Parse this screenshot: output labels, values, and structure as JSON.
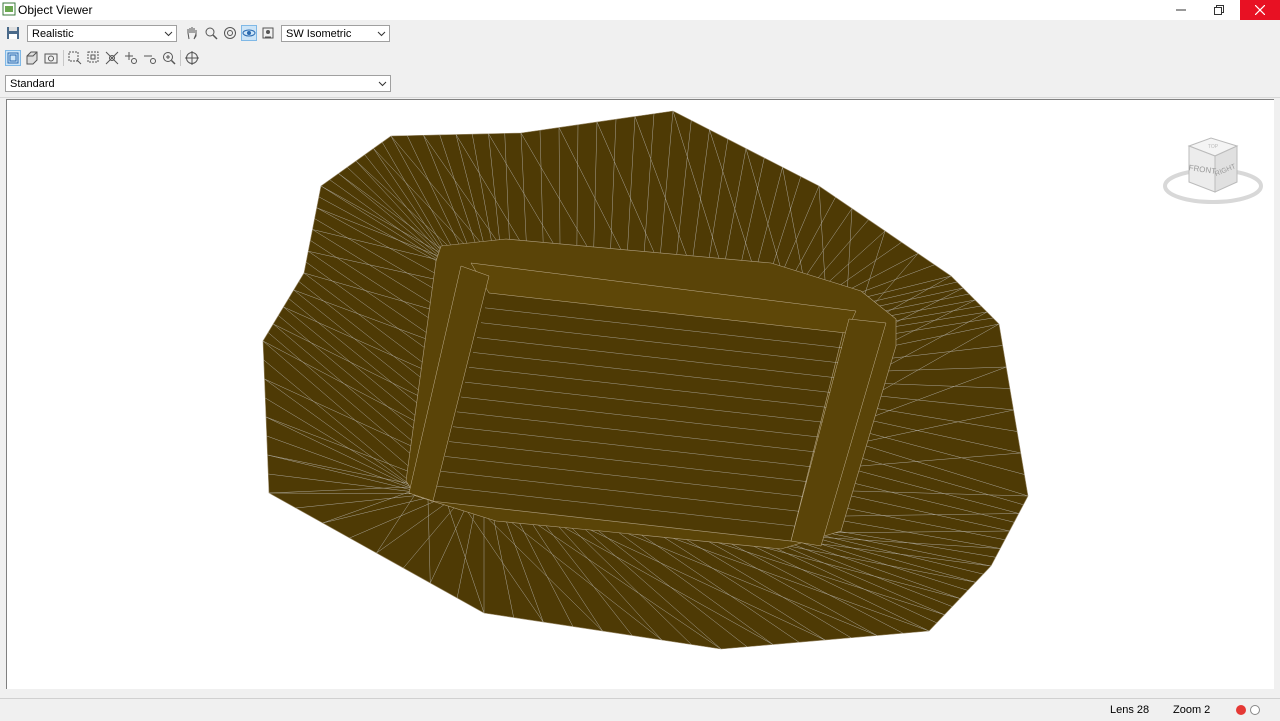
{
  "window": {
    "title": "Object Viewer",
    "close_color": "#e81123"
  },
  "toolbar": {
    "visual_style": "Realistic",
    "view_direction": "SW Isometric",
    "view_style": "Standard",
    "tools_row1": [
      "save-icon",
      "pan-icon",
      "zoom-realtime-icon",
      "orbit-icon",
      "free-orbit-icon",
      "camera-icon"
    ],
    "tools_row2": [
      "view-3d-icon",
      "box-icon",
      "camera-view-icon",
      "zoom-window-icon",
      "zoom-extents-icon",
      "zoom-all-icon",
      "zoom-in-icon",
      "zoom-out-icon",
      "zoom-scale-icon",
      "target-icon"
    ]
  },
  "viewcube": {
    "face_front": "FRONT",
    "face_right": "RIGHT",
    "face_top": "TOP"
  },
  "model": {
    "surface_color": "#4e3a05",
    "inner_surface_color": "#5a4408",
    "mesh_line_color": "#c8c8c8"
  },
  "status": {
    "lens": "Lens 28",
    "zoom": "Zoom 2",
    "indicator_on_color": "#e53935"
  }
}
